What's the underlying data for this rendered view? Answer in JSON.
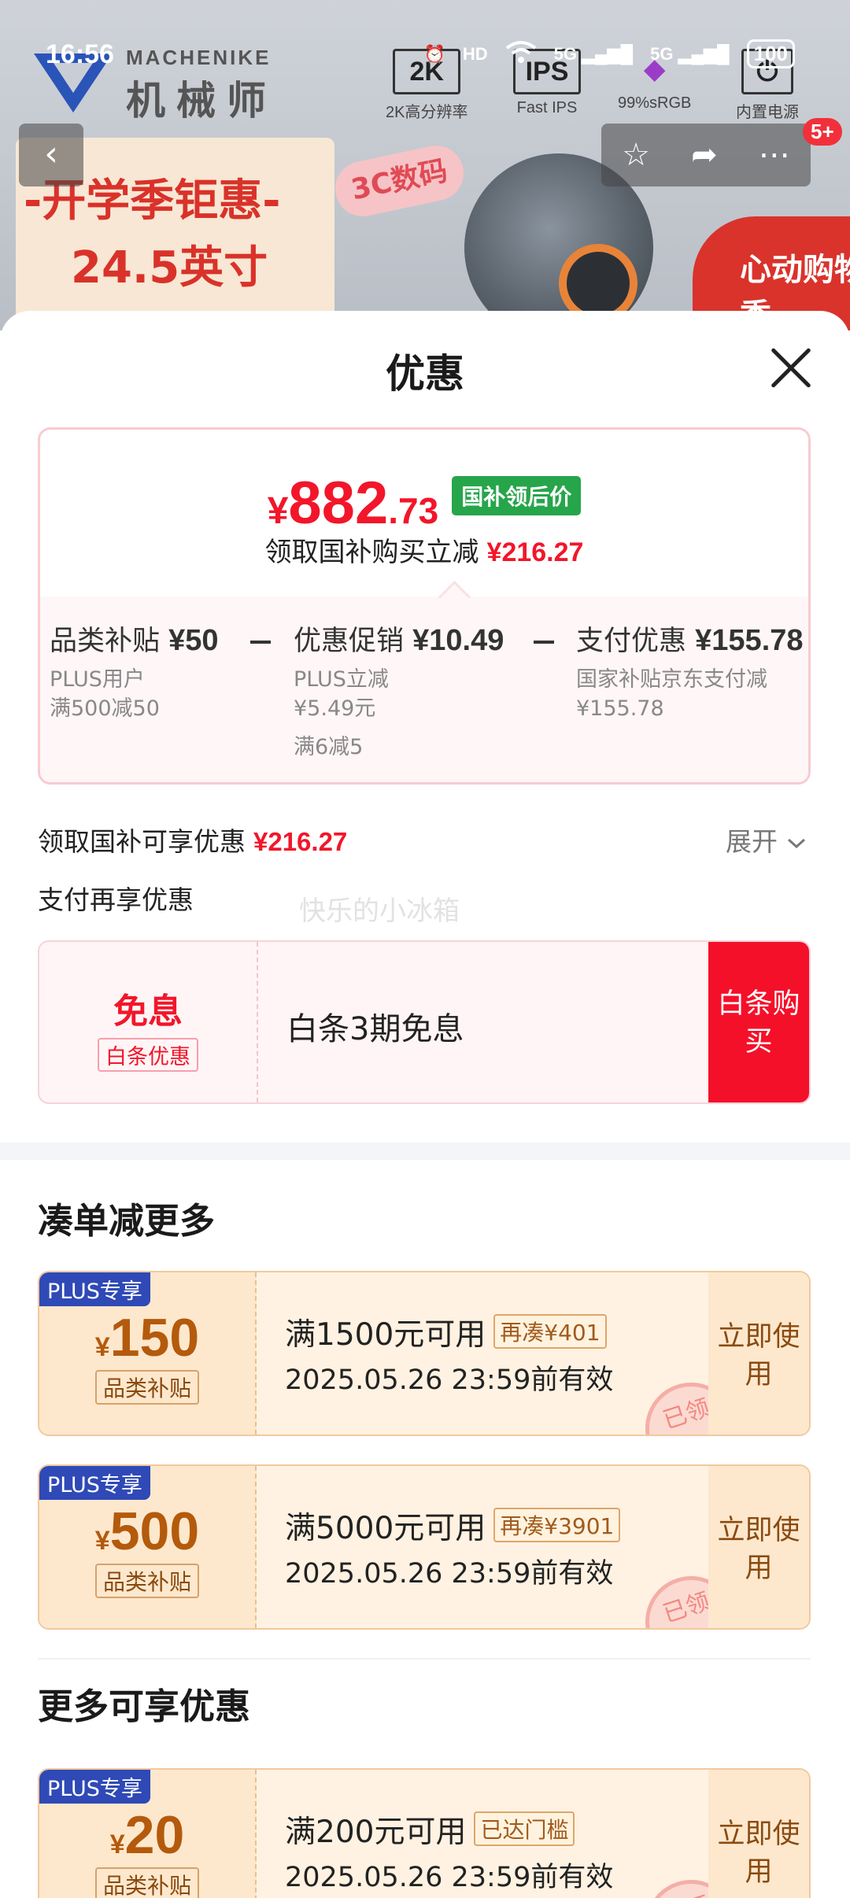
{
  "status_bar": {
    "time": "16:56",
    "network_hd": "HD",
    "signal_5g_1": "5G",
    "signal_5g_2": "5G",
    "battery": "100"
  },
  "banner": {
    "brand_en": "MACHENIKE",
    "brand_cn": "机械师",
    "features": [
      {
        "icon": "2K",
        "label": "2K高分辨率"
      },
      {
        "icon": "IPS",
        "label": "Fast IPS"
      },
      {
        "icon": "◆",
        "label": "99%sRGB"
      },
      {
        "icon": "⏻",
        "label": "内置电源"
      }
    ],
    "promo_line_1": "-开学季钜惠-",
    "promo_line_2": "24.5英寸",
    "tag_3c": "3C数码",
    "corner_text": "心动购物季"
  },
  "top_actions": {
    "cart_badge": "5+"
  },
  "sheet": {
    "title": "优惠",
    "price": {
      "currency": "¥",
      "integer": "882",
      "decimal": ".73",
      "tag": "国补领后价"
    },
    "subsidy_summary": {
      "label": "领取国补购买立减",
      "amount": "¥216.27"
    },
    "breakdown": [
      {
        "title": "品类补贴",
        "amount": "¥50",
        "lines": [
          "PLUS用户",
          "满500减50"
        ]
      },
      {
        "title": "优惠促销",
        "amount": "¥10.49",
        "lines": [
          "PLUS立减",
          "¥5.49元",
          "满6减5"
        ]
      },
      {
        "title": "支付优惠",
        "amount": "¥155.78",
        "lines": [
          "国家补贴京东支付减",
          "¥155.78"
        ]
      }
    ],
    "claim_line": {
      "label": "领取国补可享优惠",
      "amount": "¥216.27",
      "expand": "展开"
    },
    "pay_more_label": "支付再享优惠",
    "watermark": "快乐的小冰箱",
    "baitiao": {
      "badge_big": "免息",
      "badge_small": "白条优惠",
      "desc": "白条3期免息",
      "buy_label": "白条购买"
    },
    "section_more_discount": "凑单减更多",
    "coupons": [
      {
        "plus": "PLUS专享",
        "currency": "¥",
        "value": "150",
        "category": "品类补贴",
        "condition": "满1500元可用",
        "extra": "再凑¥401",
        "validity": "2025.05.26 23:59前有效",
        "use_label": "立即使用",
        "stamp": "已领"
      },
      {
        "plus": "PLUS专享",
        "currency": "¥",
        "value": "500",
        "category": "品类补贴",
        "condition": "满5000元可用",
        "extra": "再凑¥3901",
        "validity": "2025.05.26 23:59前有效",
        "use_label": "立即使用",
        "stamp": "已领"
      }
    ],
    "section_more_available": "更多可享优惠",
    "more_coupons": [
      {
        "plus": "PLUS专享",
        "currency": "¥",
        "value": "20",
        "category": "品类补贴",
        "condition": "满200元可用",
        "extra": "已达门槛",
        "validity": "2025.05.26 23:59前有效",
        "use_label": "立即使用",
        "stamp": "已领"
      }
    ]
  },
  "colors": {
    "accent_red": "#f2162a",
    "subsidy_green": "#27a54b",
    "plus_blue": "#2f49b7",
    "coupon_brown": "#b45a0c"
  }
}
